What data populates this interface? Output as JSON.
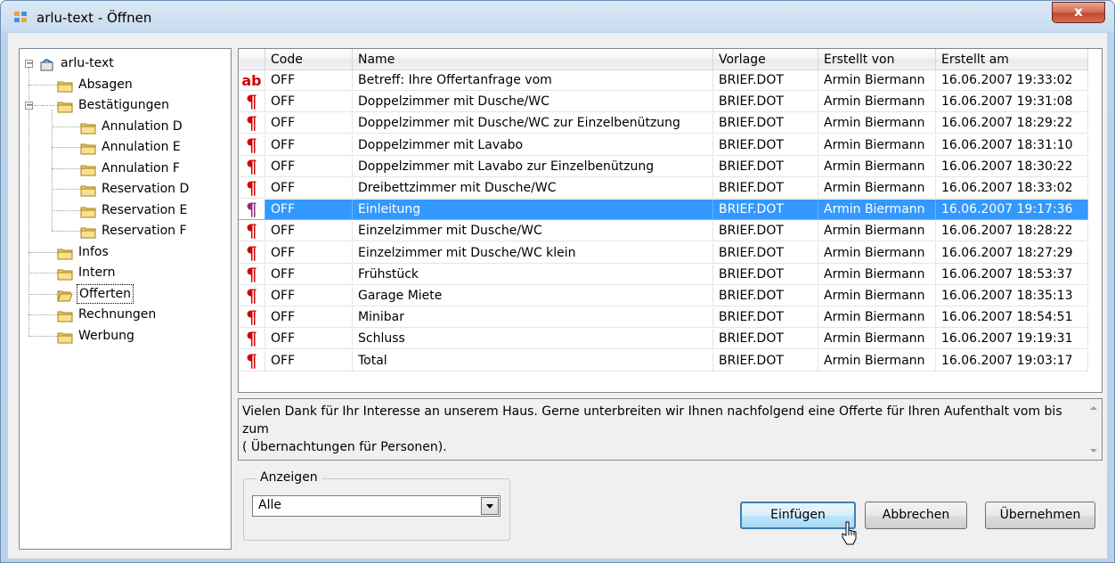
{
  "window": {
    "title": "arlu-text - Öffnen",
    "close_label": "x"
  },
  "tree": {
    "root": "arlu-text",
    "items": [
      {
        "label": "Absagen",
        "level": 1
      },
      {
        "label": "Bestätigungen",
        "level": 1,
        "expanded": true
      },
      {
        "label": "Annulation D",
        "level": 2
      },
      {
        "label": "Annulation E",
        "level": 2
      },
      {
        "label": "Annulation F",
        "level": 2
      },
      {
        "label": "Reservation D",
        "level": 2
      },
      {
        "label": "Reservation E",
        "level": 2
      },
      {
        "label": "Reservation F",
        "level": 2
      },
      {
        "label": "Infos",
        "level": 1
      },
      {
        "label": "Intern",
        "level": 1
      },
      {
        "label": "Offerten",
        "level": 1,
        "selected": true
      },
      {
        "label": "Rechnungen",
        "level": 1
      },
      {
        "label": "Werbung",
        "level": 1
      }
    ]
  },
  "grid": {
    "columns": [
      "",
      "Code",
      "Name",
      "Vorlage",
      "Erstellt von",
      "Erstellt am"
    ],
    "rows": [
      {
        "icon": "ab",
        "code": "OFF",
        "name": "Betreff: Ihre Offertanfrage vom",
        "vorlage": "BRIEF.DOT",
        "von": "Armin Biermann",
        "am": "16.06.2007 19:33:02"
      },
      {
        "icon": "¶",
        "code": "OFF",
        "name": "Doppelzimmer mit Dusche/WC",
        "vorlage": "BRIEF.DOT",
        "von": "Armin Biermann",
        "am": "16.06.2007 19:31:08"
      },
      {
        "icon": "¶",
        "code": "OFF",
        "name": "Doppelzimmer mit Dusche/WC zur Einzelbenützung",
        "vorlage": "BRIEF.DOT",
        "von": "Armin Biermann",
        "am": "16.06.2007 18:29:22"
      },
      {
        "icon": "¶",
        "code": "OFF",
        "name": "Doppelzimmer mit Lavabo",
        "vorlage": "BRIEF.DOT",
        "von": "Armin Biermann",
        "am": "16.06.2007 18:31:10"
      },
      {
        "icon": "¶",
        "code": "OFF",
        "name": "Doppelzimmer mit Lavabo zur Einzelbenützung",
        "vorlage": "BRIEF.DOT",
        "von": "Armin Biermann",
        "am": "16.06.2007 18:30:22"
      },
      {
        "icon": "¶",
        "code": "OFF",
        "name": "Dreibettzimmer mit Dusche/WC",
        "vorlage": "BRIEF.DOT",
        "von": "Armin Biermann",
        "am": "16.06.2007 18:33:02"
      },
      {
        "icon": "¶",
        "code": "OFF",
        "name": "Einleitung",
        "vorlage": "BRIEF.DOT",
        "von": "Armin Biermann",
        "am": "16.06.2007 19:17:36",
        "selected": true
      },
      {
        "icon": "¶",
        "code": "OFF",
        "name": "Einzelzimmer mit Dusche/WC",
        "vorlage": "BRIEF.DOT",
        "von": "Armin Biermann",
        "am": "16.06.2007 18:28:22"
      },
      {
        "icon": "¶",
        "code": "OFF",
        "name": "Einzelzimmer mit Dusche/WC klein",
        "vorlage": "BRIEF.DOT",
        "von": "Armin Biermann",
        "am": "16.06.2007 18:27:29"
      },
      {
        "icon": "¶",
        "code": "OFF",
        "name": "Frühstück",
        "vorlage": "BRIEF.DOT",
        "von": "Armin Biermann",
        "am": "16.06.2007 18:53:37"
      },
      {
        "icon": "¶",
        "code": "OFF",
        "name": "Garage Miete",
        "vorlage": "BRIEF.DOT",
        "von": "Armin Biermann",
        "am": "16.06.2007 18:35:13"
      },
      {
        "icon": "¶",
        "code": "OFF",
        "name": "Minibar",
        "vorlage": "BRIEF.DOT",
        "von": "Armin Biermann",
        "am": "16.06.2007 18:54:51"
      },
      {
        "icon": "¶",
        "code": "OFF",
        "name": "Schluss",
        "vorlage": "BRIEF.DOT",
        "von": "Armin Biermann",
        "am": "16.06.2007 19:19:31"
      },
      {
        "icon": "¶",
        "code": "OFF",
        "name": "Total",
        "vorlage": "BRIEF.DOT",
        "von": "Armin Biermann",
        "am": "16.06.2007 19:03:17"
      }
    ]
  },
  "preview": {
    "line1": "Vielen Dank für Ihr Interesse an unserem Haus. Gerne unterbreiten wir Ihnen nachfolgend eine Offerte für Ihren Aufenthalt vom  bis zum",
    "line2": "( Übernachtungen für  Personen)."
  },
  "filter": {
    "group_label": "Anzeigen",
    "selected": "Alle"
  },
  "buttons": {
    "insert": "Einfügen",
    "cancel": "Abbrechen",
    "apply": "Übernehmen"
  },
  "colors": {
    "selection": "#3399ff",
    "para_icon": "#d40000",
    "titlebar": "#c9dcf0"
  }
}
